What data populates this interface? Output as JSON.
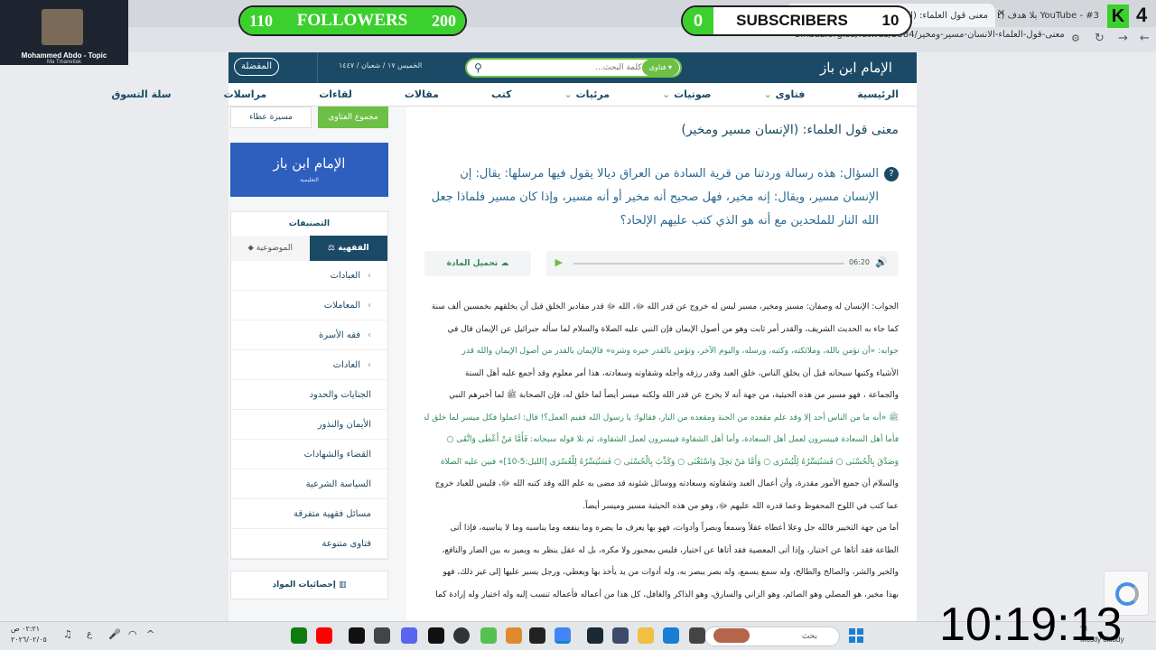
{
  "browser": {
    "tabs": [
      {
        "label": "معنى قول العلماء: (الإنسان مسير...",
        "active": true
      },
      {
        "label": "YouTube - #3 بلا هدف (1)",
        "active": false
      }
    ],
    "url": "binbaz.org.sa/fatwas/5584/معنى-قول-العلماء-الانسان-مسير-ومخير"
  },
  "overlay": {
    "followers": {
      "left": "110",
      "label": "FOLLOWERS",
      "right": "200"
    },
    "subscribers": {
      "left": "0",
      "label": "SUBSCRIBERS",
      "right": "10"
    },
    "logo_number": "4",
    "clock": "10:19:13"
  },
  "music": {
    "artist": "Mohammed Abdo - Topic",
    "track": "Ma Tmanetlak"
  },
  "header": {
    "favorites": "المفضلة",
    "date": "الخميس ١٧ / شعبان / ١٤٤٧",
    "search_placeholder": "كلمة البحث...",
    "search_scope": "فتاوى"
  },
  "nav": [
    "الرئيسية",
    "فتاوى",
    "صوتيات",
    "مرئيات",
    "كتب",
    "مقالات",
    "لقاءات",
    "مراسلات",
    "سلة التسوق"
  ],
  "sidebar": {
    "btn_fatwa_collection": "مجموع الفتاوى",
    "btn_ataa": "مسيرة عطاء",
    "banner_text": "الإمام ابن باز",
    "banner_sub": "التعليمية",
    "categories_title": "التصنيفات",
    "tab_fiqh": "الفقهية",
    "tab_topics": "الموضوعية",
    "items": [
      "العبادات",
      "المعاملات",
      "فقه الأسرة",
      "العادات",
      "الجنايات والحدود",
      "الأيمان والنذور",
      "القضاء والشهادات",
      "السياسة الشرعية",
      "مسائل فقهية متفرقة",
      "فتاوى متنوعة"
    ],
    "stats": "إحصائيات المواد"
  },
  "article": {
    "title": "معنى قول العلماء: (الإنسان مسير ومخير)",
    "question": "السؤال: هذه رسالة وردتنا من قرية السادة من العراق ديالا يقول فيها مرسلها: يقال: إن الإنسان مسير، ويقال: إنه مخير، فهل صحيح أنه مخير أو أنه مسير، وإذا كان مسير فلماذا جعل الله النار للملحدين مع أنه هو الذي كتب عليهم الإلحاد؟",
    "download": "تحميل المادة",
    "duration": "06:20",
    "answer_lines": [
      "الجواب: الإنسان له وصفان: مسير ومخير، مسير ليس له خروج عن قدر الله ﷻ، الله ﷻ قدر مقادير الخلق قبل أن يخلقهم بخمسين ألف سنة",
      "كما جاء به الحديث الشريف، والقدر أمر ثابت وهو من أصول الإيمان فإن النبي عليه الصلاة والسلام لما سأله جبرائيل عن الإيمان قال في",
      "جوابه: «أن تؤمن بالله، وملائكته، وكتبه، ورسله، واليوم الآخر، وتؤمن بالقدر خيره وشره» فالإيمان بالقدر من أصول الإيمان والله قدر",
      "الأشياء وكتبها سبحانه قبل أن يخلق الناس، خلق العبد وقدر رزقه وأجله وشقاوته وسعادته، هذا أمر معلوم وقد أجمع عليه أهل السنة",
      "والجماعة ، فهو مسير من هذه الحيثية، من جهة أنه لا يخرج عن قدر الله ولكنه ميسر أيضاً لما خلق له، فإن الصحابة ﷺ لما أخبرهم النبي",
      "ﷺ «أنه ما من الناس أحد إلا وقد علم مقعده من الجنة ومقعده من النار، فقالوا: يا رسول الله ففيم العمل؟! قال: اعملوا فكل ميسر لما خلق له",
      "فأما أهل السعادة فييسرون لعمل أهل السعادة، وأما أهل الشقاوة فييسرون لعمل الشقاوة، ثم تلا قوله سبحانه: فَأَمَّا مَنْ أَعْطَى وَاتَّقَى ○",
      "وَصَدَّقَ بِالْحُسْنَى ○ فَسَنُيَسِّرُهُ لِلْيُسْرَى ○ وَأَمَّا مَنْ بَخِلَ وَاسْتَغْنَى ○ وَكَذَّبَ بِالْحُسْنَى ○ فَسَنُيَسِّرُهُ لِلْعُسْرَى [الليل:5-10]» فبين عليه الصلاة",
      "والسلام أن جميع الأمور مقدرة، وأن أعمال العبد وشقاوته وسعادته ووسائل شئونه قد مضى به علم الله وقد كتبه الله ﷻ، فليس للعباد خروج",
      "عما كتب في اللوح المحفوظ وعما قدره الله عليهم ﷻ، وهو من هذه الحيثية مسير وميسر أيضاً.",
      "أما من جهة التخيير فالله جل وعلا أعطاه عقلاً وسمعاً وبصراً وأدوات، فهو بها يعرف ما يضره وما ينفعه وما يناسبه وما لا يناسبه، فإذا أتى",
      "الطاعة فقد أتاها عن اختيار، وإذا أتى المعصية فقد أتاها عن اختيار، فليس بمجبور ولا مكره، بل له عقل ينظر به ويميز به بين الضار والنافع،",
      "والخير والشر، والصالح والطالح، وله سمع يسمع، وله بصر يبصر به، وله أدوات من يد يأخذ بها ويعطي، ورجل يسير عليها إلى غير ذلك، فهو",
      "بهذا مخير، هو المصلي وهو الصائم، وهو الزاني والسارق، وهو الذاكر والغافل، كل هذا من أعماله فأعماله تنسب إليه وله اختيار وله إرادة كما"
    ],
    "green_lines": [
      2,
      5,
      6,
      7
    ]
  },
  "taskbar": {
    "search": "بحث",
    "weather": "Mostly cloudy",
    "temp": "°8",
    "time": "٠٢:٢١ ص",
    "date": "٢٠٢٦/٠٢/٠٥"
  }
}
